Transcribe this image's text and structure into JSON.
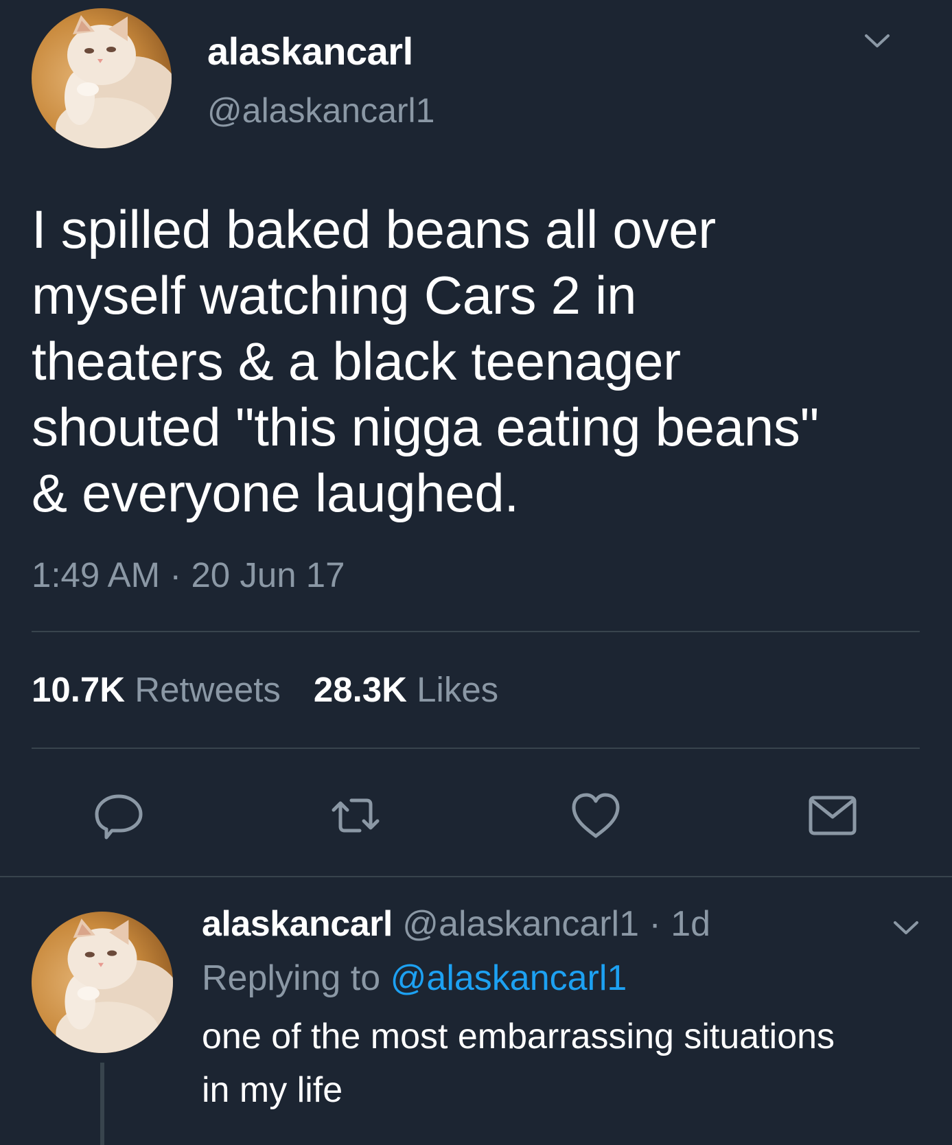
{
  "main_tweet": {
    "display_name": "alaskancarl",
    "handle": "@alaskancarl1",
    "avatar_icon": "cat-photo-avatar",
    "text_lines": [
      "I spilled baked beans all over",
      "myself watching Cars 2 in",
      "theaters & a black teenager",
      "shouted \"this nigga eating beans\"",
      "& everyone laughed."
    ],
    "timestamp": "1:49 AM · 20 Jun 17",
    "retweets_count": "10.7K",
    "retweets_label": "Retweets",
    "likes_count": "28.3K",
    "likes_label": "Likes",
    "actions": [
      {
        "icon": "reply-icon"
      },
      {
        "icon": "retweet-icon"
      },
      {
        "icon": "like-icon"
      },
      {
        "icon": "direct-message-icon"
      }
    ]
  },
  "reply_tweet": {
    "display_name": "alaskancarl",
    "handle": "@alaskancarl1",
    "separator": "·",
    "time": "1d",
    "replying_prefix": "Replying to",
    "replying_to": "@alaskancarl1",
    "text_lines": [
      "one of the most embarrassing situations",
      "in my life"
    ]
  },
  "colors": {
    "background": "#1c2532",
    "text_primary": "#ffffff",
    "text_secondary": "#8b98a5",
    "divider": "#38444d",
    "link": "#1da1f2"
  }
}
